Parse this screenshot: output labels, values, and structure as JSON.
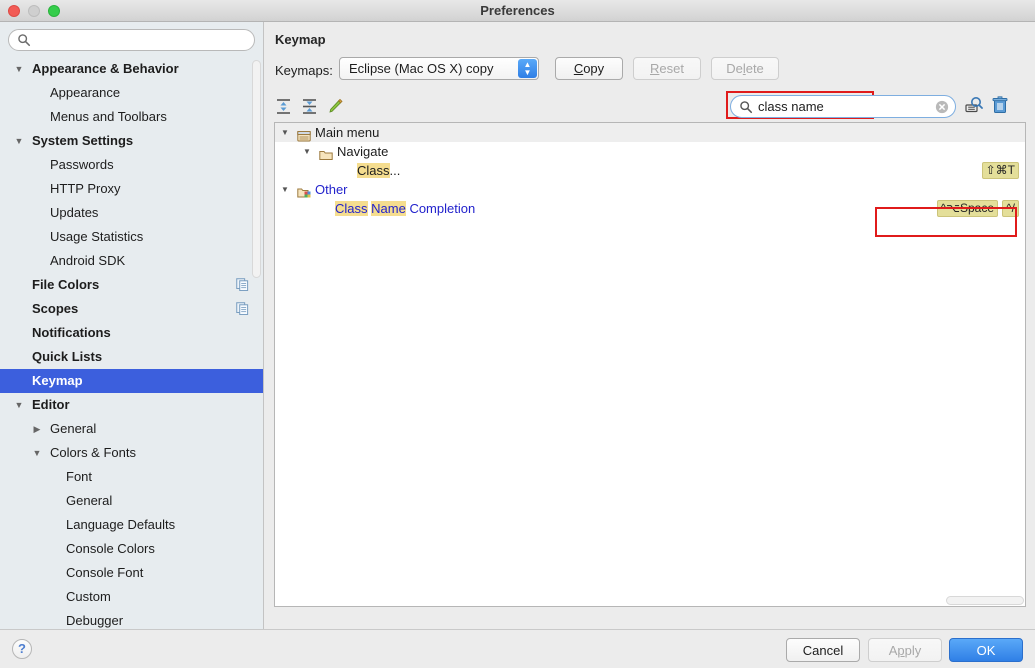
{
  "window": {
    "title": "Preferences",
    "controls": [
      "close-button",
      "minimize-button",
      "zoom-button"
    ]
  },
  "sidebar": {
    "search": {
      "value": "",
      "placeholder": "",
      "icon": "search-icon"
    },
    "items": [
      {
        "label": "Appearance & Behavior",
        "level": 0,
        "twisty": "▼",
        "selected": false,
        "badge": ""
      },
      {
        "label": "Appearance",
        "level": 1,
        "twisty": "",
        "selected": false,
        "badge": ""
      },
      {
        "label": "Menus and Toolbars",
        "level": 1,
        "twisty": "",
        "selected": false,
        "badge": ""
      },
      {
        "label": "System Settings",
        "level": 0,
        "twisty": "▼",
        "selected": false,
        "badge": ""
      },
      {
        "label": "Passwords",
        "level": 1,
        "twisty": "",
        "selected": false,
        "badge": ""
      },
      {
        "label": "HTTP Proxy",
        "level": 1,
        "twisty": "",
        "selected": false,
        "badge": ""
      },
      {
        "label": "Updates",
        "level": 1,
        "twisty": "",
        "selected": false,
        "badge": ""
      },
      {
        "label": "Usage Statistics",
        "level": 1,
        "twisty": "",
        "selected": false,
        "badge": ""
      },
      {
        "label": "Android SDK",
        "level": 1,
        "twisty": "",
        "selected": false,
        "badge": ""
      },
      {
        "label": "File Colors",
        "level": 0,
        "twisty": "",
        "selected": false,
        "badge": "copy-icon"
      },
      {
        "label": "Scopes",
        "level": 0,
        "twisty": "",
        "selected": false,
        "badge": "copy-icon"
      },
      {
        "label": "Notifications",
        "level": 0,
        "twisty": "",
        "selected": false,
        "badge": ""
      },
      {
        "label": "Quick Lists",
        "level": 0,
        "twisty": "",
        "selected": false,
        "badge": ""
      },
      {
        "label": "Keymap",
        "level": 0,
        "twisty": "",
        "selected": true,
        "badge": ""
      },
      {
        "label": "Editor",
        "level": 0,
        "twisty": "▼",
        "selected": false,
        "badge": ""
      },
      {
        "label": "General",
        "level": 1,
        "twisty": "▶",
        "selected": false,
        "badge": ""
      },
      {
        "label": "Colors & Fonts",
        "level": 1,
        "twisty": "▼",
        "selected": false,
        "badge": ""
      },
      {
        "label": "Font",
        "level": 2,
        "twisty": "",
        "selected": false,
        "badge": ""
      },
      {
        "label": "General",
        "level": 2,
        "twisty": "",
        "selected": false,
        "badge": ""
      },
      {
        "label": "Language Defaults",
        "level": 2,
        "twisty": "",
        "selected": false,
        "badge": ""
      },
      {
        "label": "Console Colors",
        "level": 2,
        "twisty": "",
        "selected": false,
        "badge": ""
      },
      {
        "label": "Console Font",
        "level": 2,
        "twisty": "",
        "selected": false,
        "badge": ""
      },
      {
        "label": "Custom",
        "level": 2,
        "twisty": "",
        "selected": false,
        "badge": ""
      },
      {
        "label": "Debugger",
        "level": 2,
        "twisty": "",
        "selected": false,
        "badge": ""
      }
    ]
  },
  "main": {
    "title": "Keymap",
    "keymaps_label": "Keymaps:",
    "keymap_selected": "Eclipse (Mac OS X) copy",
    "buttons": {
      "copy": {
        "pre": "",
        "mnemonic": "C",
        "post": "opy",
        "enabled": true
      },
      "reset": {
        "pre": "",
        "mnemonic": "R",
        "post": "eset",
        "enabled": false
      },
      "delete": {
        "pre": "De",
        "mnemonic": "l",
        "post": "ete",
        "enabled": false
      }
    },
    "toolbar_icons": [
      "expand-all-icon",
      "collapse-all-icon",
      "edit-shortcut-icon"
    ],
    "search": {
      "value": "class name",
      "icon": "search-icon",
      "clear_icon": "clear-icon",
      "highlighted": true
    },
    "right_icons": [
      "find-by-shortcut-icon",
      "delete-shortcut-icon"
    ]
  },
  "tree": [
    {
      "name": "Main menu",
      "level": 0,
      "twisty": "▼",
      "icon": "main-menu-icon",
      "header": true,
      "color": "default",
      "segments": [
        {
          "t": "Main menu",
          "h": false
        }
      ],
      "shortcuts": []
    },
    {
      "name": "Navigate",
      "level": 1,
      "twisty": "▼",
      "icon": "folder-icon",
      "header": false,
      "color": "default",
      "segments": [
        {
          "t": "Navigate",
          "h": false
        }
      ],
      "shortcuts": []
    },
    {
      "name": "Class...",
      "level": 3,
      "twisty": "",
      "icon": "",
      "header": false,
      "color": "default",
      "segments": [
        {
          "t": "Class",
          "h": true
        },
        {
          "t": "...",
          "h": false
        }
      ],
      "shortcuts": [
        "⇧⌘T"
      ]
    },
    {
      "name": "Other",
      "level": 0,
      "twisty": "▼",
      "icon": "plugin-folder-icon",
      "header": false,
      "color": "blue",
      "segments": [
        {
          "t": "Other",
          "h": false
        }
      ],
      "shortcuts": []
    },
    {
      "name": "Class Name Completion",
      "level": 2,
      "twisty": "",
      "icon": "",
      "header": false,
      "color": "blue",
      "segments": [
        {
          "t": "Class",
          "h": true
        },
        {
          "t": " ",
          "h": false
        },
        {
          "t": "Name",
          "h": true
        },
        {
          "t": " Completion",
          "h": false
        }
      ],
      "shortcuts": [
        "^⌥Space",
        "^/"
      ]
    }
  ],
  "footer": {
    "help": "?",
    "cancel": "Cancel",
    "apply": {
      "pre": "A",
      "mnemonic": "p",
      "post": "ply"
    },
    "ok": "OK"
  },
  "colors": {
    "selection_blue": "#3c5fdd",
    "highlight_red": "#e01b1b",
    "match_yellow": "#f5dd8f",
    "shortcut_badge": "#e4df9a",
    "link_blue": "#2222cc",
    "ok_blue": "#2f7fe6"
  }
}
